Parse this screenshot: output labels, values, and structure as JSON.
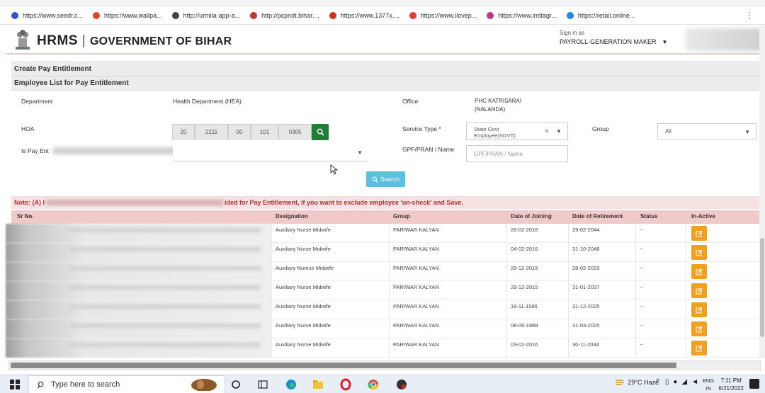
{
  "browser": {
    "bookmarks": [
      {
        "label": "https://www.seedr.c...",
        "color": "#3c4ed8"
      },
      {
        "label": "https://www.wallpa...",
        "color": "#e2452a"
      },
      {
        "label": "http://urmila-app-a...",
        "color": "#444444"
      },
      {
        "label": "http://pcpndt.bihar....",
        "color": "#c0392b"
      },
      {
        "label": "https://www.1377x....",
        "color": "#d62d20"
      },
      {
        "label": "https://www.ilovep...",
        "color": "#e53935"
      },
      {
        "label": "https://www.instagr...",
        "color": "#c13584"
      },
      {
        "label": "https://retail.online...",
        "color": "#1e88e5"
      }
    ]
  },
  "header": {
    "brand": "HRMS",
    "separator": "|",
    "government": "GOVERNMENT OF BIHAR",
    "signin_label": "Sign in as",
    "role": "PAYROLL-GENERATION MAKER",
    "role_caret": "▼"
  },
  "page": {
    "title": "Create Pay Entitlement",
    "subtitle": "Employee List for Pay Entitlement"
  },
  "form": {
    "department_label": "Department",
    "department_value": "Health Department (HEA)",
    "office_label": "Office",
    "office_value_line1": "PHC KATRISARAI",
    "office_value_line2": "(NALANDA)",
    "hoa_label": "HOA",
    "hoa_parts": [
      "20",
      "2211",
      "00",
      "101",
      "0305"
    ],
    "service_type_label": "Service Type *",
    "service_type_value_line1": "State Govt",
    "service_type_value_line2": "Employee(SGVT)",
    "service_type_clear": "×",
    "group_label": "Group",
    "group_value": "All",
    "is_pay_label": "Is Pay Ent",
    "gpf_label": "GPF/PRAN / Name",
    "gpf_placeholder": "GPF/PRAN / Name",
    "search_button": "Search"
  },
  "note": {
    "prefix": "Note: (A) I",
    "suffix": "ided for Pay Entitlement, if you want to exclude employee 'un-check' and Save."
  },
  "table": {
    "headers": {
      "sr_no": "Sr No.",
      "designation": "Designation",
      "group": "Group",
      "doj": "Date of Joining",
      "dor": "Date of Retirement",
      "status": "Status",
      "in_active": "In-Active"
    },
    "rows": [
      {
        "designation": "Auxiliary Nurse Midwife",
        "group": "PARIWAR KALYAN",
        "doj": "26-02-2016",
        "dor": "29-02-2044",
        "status": "--"
      },
      {
        "designation": "Auxiliary Nurse Midwife",
        "group": "PARIWAR KALYAN",
        "doj": "04-02-2016",
        "dor": "31-10-2048",
        "status": "--"
      },
      {
        "designation": "Auxiliary Nurese Midwife",
        "group": "PARIWAR KALYAN",
        "doj": "29-12-2015",
        "dor": "28-02-2033",
        "status": "--"
      },
      {
        "designation": "Auxiliary Nurse Midwife",
        "group": "PARIWAR KALYAN",
        "doj": "29-12-2015",
        "dor": "31-01-2037",
        "status": "--"
      },
      {
        "designation": "Auxiliary Nurse Midwife",
        "group": "PARIWAR KALYAN",
        "doj": "19-11-1986",
        "dor": "31-12-2025",
        "status": "--"
      },
      {
        "designation": "Auxiliary Nurse Midwife",
        "group": "PARIWAR KALYAN",
        "doj": "08-06-1988",
        "dor": "31-03-2025",
        "status": "--"
      },
      {
        "designation": "Auxiliary Nurse Midwife",
        "group": "PARIWAR KALYAN",
        "doj": "03-02-2016",
        "dor": "30-11-2034",
        "status": "--"
      }
    ]
  },
  "taskbar": {
    "search_placeholder": "Type here to search",
    "weather": "29°C Haze",
    "lang_line1": "ENG",
    "lang_line2": "IN",
    "time": "7:11 PM",
    "date": "6/21/2022"
  },
  "colors": {
    "accent_pink": "#f2c9c9",
    "note_red": "#b03030",
    "search_blue": "#5bc0de",
    "hoa_green": "#1e7e34",
    "edit_orange": "#f0a020"
  }
}
